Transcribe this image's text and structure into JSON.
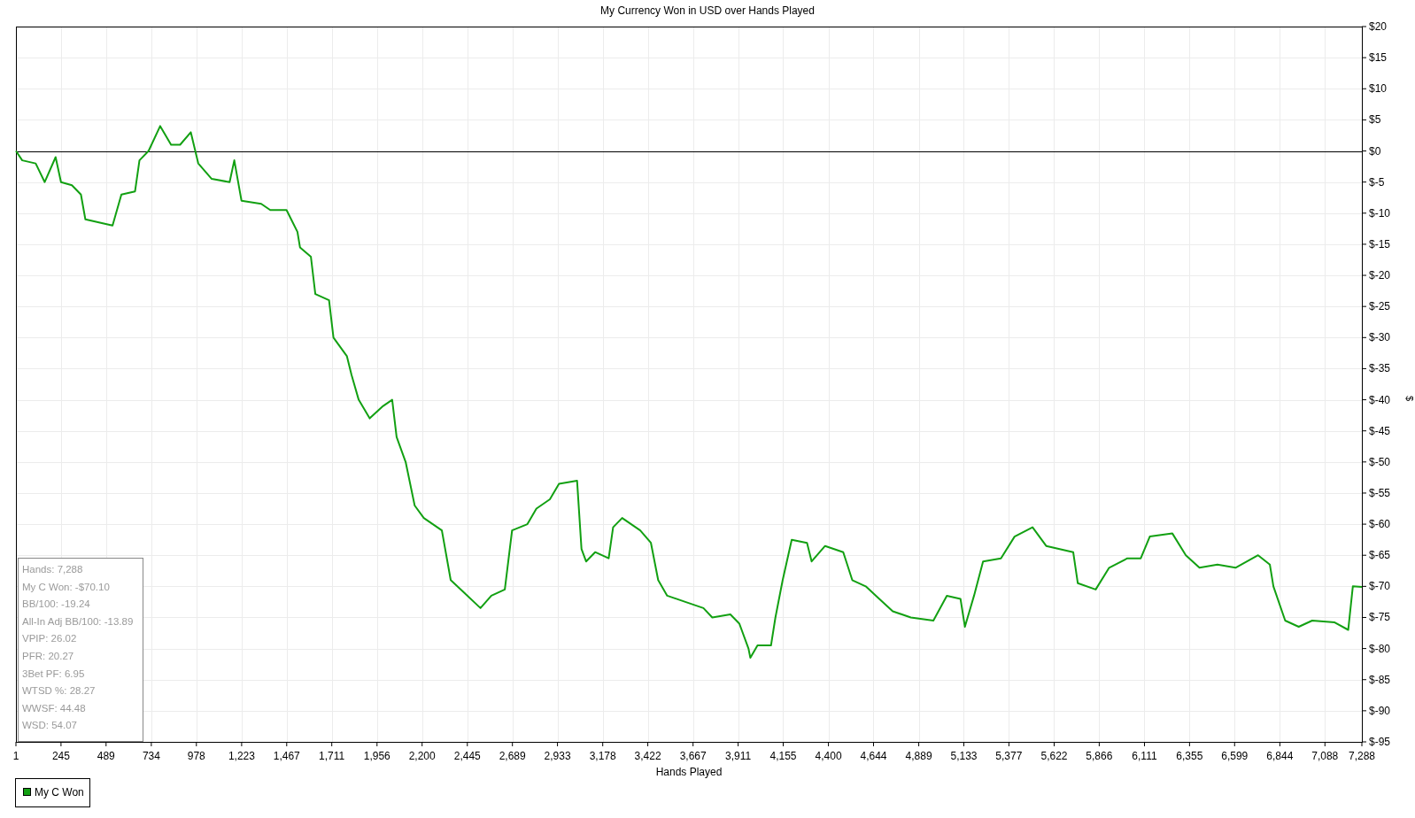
{
  "chart": {
    "chart_data": {
      "type": "line",
      "title": "My Currency Won in USD over Hands Played",
      "xlabel": "Hands Played",
      "ylabel": "$",
      "x": [
        1,
        35,
        108,
        157,
        216,
        245,
        304,
        353,
        377,
        450,
        524,
        572,
        646,
        670,
        719,
        782,
        841,
        890,
        948,
        988,
        1061,
        1158,
        1183,
        1222,
        1329,
        1378,
        1466,
        1525,
        1539,
        1598,
        1622,
        1696,
        1720,
        1793,
        1818,
        1857,
        1916,
        1989,
        2038,
        2062,
        2111,
        2160,
        2209,
        2307,
        2355,
        2428,
        2516,
        2575,
        2648,
        2687,
        2770,
        2819,
        2892,
        2941,
        3039,
        3063,
        3088,
        3137,
        3210,
        3234,
        3283,
        3381,
        3439,
        3478,
        3527,
        3625,
        3723,
        3771,
        3869,
        3918,
        3967,
        3977,
        4016,
        4089,
        4113,
        4152,
        4201,
        4284,
        4309,
        4382,
        4480,
        4529,
        4602,
        4675,
        4748,
        4846,
        4968,
        5041,
        5115,
        5139,
        5188,
        5237,
        5334,
        5408,
        5505,
        5579,
        5725,
        5750,
        5847,
        5920,
        6018,
        6091,
        6140,
        6262,
        6335,
        6409,
        6506,
        6604,
        6726,
        6790,
        6809,
        6873,
        6946,
        7019,
        7141,
        7214,
        7239,
        7288
      ],
      "series": [
        {
          "name": "My C Won",
          "color": "#12a012",
          "values": [
            0,
            -1.5,
            -2,
            -5,
            -1,
            -5,
            -5.5,
            -7,
            -11,
            -11.5,
            -12,
            -7,
            -6.5,
            -1.5,
            0,
            4,
            1,
            1,
            3,
            -2,
            -4.5,
            -5,
            -1.5,
            -8,
            -8.5,
            -9.5,
            -9.5,
            -13,
            -15.5,
            -17,
            -23,
            -24,
            -30,
            -33,
            -36,
            -40,
            -43,
            -41,
            -40,
            -46,
            -50,
            -57,
            -59,
            -61,
            -69,
            -71,
            -73.5,
            -71.5,
            -70.5,
            -61,
            -60,
            -57.5,
            -56,
            -53.5,
            -53,
            -64,
            -66,
            -64.5,
            -65.5,
            -60.5,
            -59,
            -61,
            -63,
            -69,
            -71.5,
            -72.5,
            -73.5,
            -75,
            -74.5,
            -76,
            -80,
            -81.5,
            -79.5,
            -79.5,
            -75,
            -69,
            -62.5,
            -63,
            -66,
            -63.5,
            -64.5,
            -69,
            -70,
            -72,
            -74,
            -75,
            -75.5,
            -71.5,
            -72,
            -76.5,
            -71.5,
            -66,
            -65.5,
            -62,
            -60.5,
            -63.5,
            -64.5,
            -69.5,
            -70.5,
            -67,
            -65.5,
            -65.5,
            -62,
            -61.5,
            -65,
            -67,
            -66.5,
            -67,
            -65,
            -66.5,
            -70,
            -75.5,
            -76.5,
            -75.5,
            -75.8,
            -77,
            -70,
            -70.1
          ]
        }
      ],
      "xlim": [
        1,
        7288
      ],
      "ylim": [
        -95,
        20
      ],
      "grid": true,
      "xticks": [
        {
          "value": 1,
          "label": "1"
        },
        {
          "value": 245,
          "label": "245"
        },
        {
          "value": 489,
          "label": "489"
        },
        {
          "value": 734,
          "label": "734"
        },
        {
          "value": 978,
          "label": "978"
        },
        {
          "value": 1223,
          "label": "1,223"
        },
        {
          "value": 1467,
          "label": "1,467"
        },
        {
          "value": 1711,
          "label": "1,711"
        },
        {
          "value": 1956,
          "label": "1,956"
        },
        {
          "value": 2200,
          "label": "2,200"
        },
        {
          "value": 2445,
          "label": "2,445"
        },
        {
          "value": 2689,
          "label": "2,689"
        },
        {
          "value": 2933,
          "label": "2,933"
        },
        {
          "value": 3178,
          "label": "3,178"
        },
        {
          "value": 3422,
          "label": "3,422"
        },
        {
          "value": 3667,
          "label": "3,667"
        },
        {
          "value": 3911,
          "label": "3,911"
        },
        {
          "value": 4155,
          "label": "4,155"
        },
        {
          "value": 4400,
          "label": "4,400"
        },
        {
          "value": 4644,
          "label": "4,644"
        },
        {
          "value": 4889,
          "label": "4,889"
        },
        {
          "value": 5133,
          "label": "5,133"
        },
        {
          "value": 5377,
          "label": "5,377"
        },
        {
          "value": 5622,
          "label": "5,622"
        },
        {
          "value": 5866,
          "label": "5,866"
        },
        {
          "value": 6111,
          "label": "6,111"
        },
        {
          "value": 6355,
          "label": "6,355"
        },
        {
          "value": 6599,
          "label": "6,599"
        },
        {
          "value": 6844,
          "label": "6,844"
        },
        {
          "value": 7088,
          "label": "7,088"
        },
        {
          "value": 7288,
          "label": "7,288"
        }
      ],
      "yticks": [
        {
          "value": 20,
          "label": "$20"
        },
        {
          "value": 15,
          "label": "$15"
        },
        {
          "value": 10,
          "label": "$10"
        },
        {
          "value": 5,
          "label": "$5"
        },
        {
          "value": 0,
          "label": "$0"
        },
        {
          "value": -5,
          "label": "$-5"
        },
        {
          "value": -10,
          "label": "$-10"
        },
        {
          "value": -15,
          "label": "$-15"
        },
        {
          "value": -20,
          "label": "$-20"
        },
        {
          "value": -25,
          "label": "$-25"
        },
        {
          "value": -30,
          "label": "$-30"
        },
        {
          "value": -35,
          "label": "$-35"
        },
        {
          "value": -40,
          "label": "$-40"
        },
        {
          "value": -45,
          "label": "$-45"
        },
        {
          "value": -50,
          "label": "$-50"
        },
        {
          "value": -55,
          "label": "$-55"
        },
        {
          "value": -60,
          "label": "$-60"
        },
        {
          "value": -65,
          "label": "$-65"
        },
        {
          "value": -70,
          "label": "$-70"
        },
        {
          "value": -75,
          "label": "$-75"
        },
        {
          "value": -80,
          "label": "$-80"
        },
        {
          "value": -85,
          "label": "$-85"
        },
        {
          "value": -90,
          "label": "$-90"
        },
        {
          "value": -95,
          "label": "$-95"
        }
      ]
    }
  },
  "stats": [
    "Hands: 7,288",
    "My C Won: -$70.10",
    "BB/100: -19.24",
    "All-In Adj BB/100: -13.89",
    "VPIP: 26.02",
    "PFR: 20.27",
    "3Bet PF: 6.95",
    "WTSD %: 28.27",
    "WWSF: 44.48",
    "WSD: 54.07"
  ]
}
